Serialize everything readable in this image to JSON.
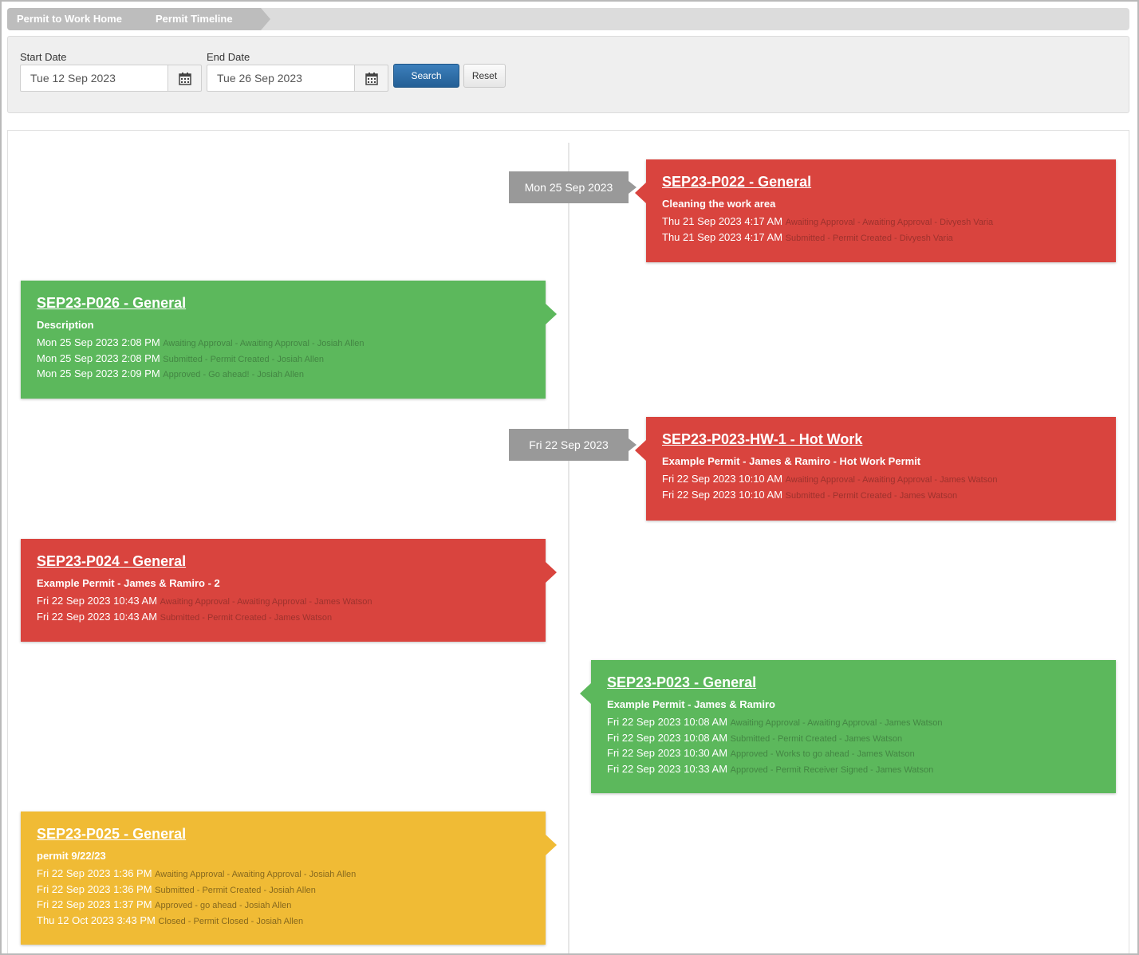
{
  "breadcrumb": {
    "home": "Permit to Work Home",
    "current": "Permit Timeline"
  },
  "filter": {
    "start_label": "Start Date",
    "start_value": "Tue 12 Sep 2023",
    "end_label": "End Date",
    "end_value": "Tue 26 Sep 2023",
    "search_label": "Search",
    "reset_label": "Reset"
  },
  "timeline": {
    "date_badges": [
      "Mon 25 Sep 2023",
      "Fri 22 Sep 2023"
    ],
    "permits": [
      {
        "title": "SEP23-P022 - General",
        "description": "Cleaning the work area",
        "status_color": "red",
        "events": [
          {
            "time": "Thu 21 Sep 2023 4:17 AM",
            "info": "Awaiting Approval - Awaiting Approval - Divyesh Varia"
          },
          {
            "time": "Thu 21 Sep 2023 4:17 AM",
            "info": "Submitted - Permit Created - Divyesh Varia"
          }
        ]
      },
      {
        "title": "SEP23-P026 - General",
        "description": "Description",
        "status_color": "green",
        "events": [
          {
            "time": "Mon 25 Sep 2023 2:08 PM",
            "info": "Awaiting Approval - Awaiting Approval - Josiah Allen"
          },
          {
            "time": "Mon 25 Sep 2023 2:08 PM",
            "info": "Submitted - Permit Created - Josiah Allen"
          },
          {
            "time": "Mon 25 Sep 2023 2:09 PM",
            "info": "Approved - Go ahead! - Josiah Allen"
          }
        ]
      },
      {
        "title": "SEP23-P023-HW-1 - Hot Work",
        "description": "Example Permit - James & Ramiro - Hot Work Permit",
        "status_color": "red",
        "events": [
          {
            "time": "Fri 22 Sep 2023 10:10 AM",
            "info": "Awaiting Approval - Awaiting Approval - James Watson"
          },
          {
            "time": "Fri 22 Sep 2023 10:10 AM",
            "info": "Submitted - Permit Created - James Watson"
          }
        ]
      },
      {
        "title": "SEP23-P024 - General",
        "description": "Example Permit - James & Ramiro - 2",
        "status_color": "red",
        "events": [
          {
            "time": "Fri 22 Sep 2023 10:43 AM",
            "info": "Awaiting Approval - Awaiting Approval - James Watson"
          },
          {
            "time": "Fri 22 Sep 2023 10:43 AM",
            "info": "Submitted - Permit Created - James Watson"
          }
        ]
      },
      {
        "title": "SEP23-P023 - General",
        "description": "Example Permit - James & Ramiro",
        "status_color": "green",
        "events": [
          {
            "time": "Fri 22 Sep 2023 10:08 AM",
            "info": "Awaiting Approval - Awaiting Approval - James Watson"
          },
          {
            "time": "Fri 22 Sep 2023 10:08 AM",
            "info": "Submitted - Permit Created - James Watson"
          },
          {
            "time": "Fri 22 Sep 2023 10:30 AM",
            "info": "Approved - Works to go ahead - James Watson"
          },
          {
            "time": "Fri 22 Sep 2023 10:33 AM",
            "info": "Approved - Permit Receiver Signed - James Watson"
          }
        ]
      },
      {
        "title": "SEP23-P025 - General",
        "description": "permit 9/22/23",
        "status_color": "yellow",
        "events": [
          {
            "time": "Fri 22 Sep 2023 1:36 PM",
            "info": "Awaiting Approval - Awaiting Approval - Josiah Allen"
          },
          {
            "time": "Fri 22 Sep 2023 1:36 PM",
            "info": "Submitted - Permit Created - Josiah Allen"
          },
          {
            "time": "Fri 22 Sep 2023 1:37 PM",
            "info": "Approved - go ahead - Josiah Allen"
          },
          {
            "time": "Thu 12 Oct 2023 3:43 PM",
            "info": "Closed - Permit Closed - Josiah Allen"
          }
        ]
      }
    ]
  },
  "icons": {
    "calendar": "calendar-icon"
  },
  "colors": {
    "red": "#d9443e",
    "green": "#5cb85c",
    "yellow": "#f0bb35",
    "badge": "#999999",
    "search_button": "#2f6fa8"
  }
}
